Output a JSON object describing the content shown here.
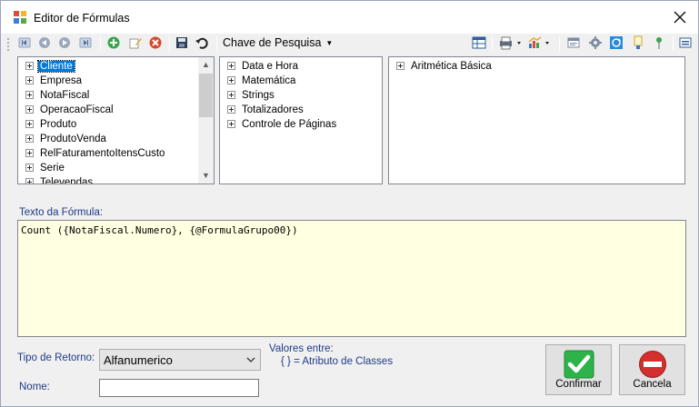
{
  "window": {
    "title": "Editor de Fórmulas"
  },
  "toolbar": {
    "search_label": "Chave de Pesquisa",
    "left_icons": [
      "first-icon",
      "prev-icon",
      "next-icon",
      "last-icon",
      "add-icon",
      "edit-icon",
      "delete-icon",
      "save-icon",
      "undo-icon"
    ],
    "right_icons": [
      "grid-icon",
      "print-icon",
      "chart-icon",
      "window-icon",
      "gear-icon",
      "refresh-icon",
      "filter-icon",
      "pin-icon",
      "menu-icon"
    ]
  },
  "tree_left": {
    "items": [
      "Cliente",
      "Empresa",
      "NotaFiscal",
      "OperacaoFiscal",
      "Produto",
      "ProdutoVenda",
      "RelFaturamentoItensCusto",
      "Serie",
      "Televendas"
    ],
    "selected": "Cliente"
  },
  "tree_middle": {
    "items": [
      "Data e Hora",
      "Matemática",
      "Strings",
      "Totalizadores",
      "Controle de Páginas"
    ]
  },
  "tree_right": {
    "items": [
      "Aritmética Básica"
    ]
  },
  "formula": {
    "label": "Texto da Fórmula:",
    "text": "Count ({NotaFiscal.Numero}, {@FormulaGrupo00})"
  },
  "return_type": {
    "label": "Tipo de Retorno:",
    "value": "Alfanumerico"
  },
  "hint": {
    "line1": "Valores entre:",
    "line2": "{ } = Atributo de Classes"
  },
  "name_field": {
    "label": "Nome:",
    "value": ""
  },
  "buttons": {
    "confirm": "Confirmar",
    "cancel": "Cancela"
  },
  "colors": {
    "selection": "#0078d7",
    "formula_bg": "#ffffe1",
    "label_blue": "#1f3a8a",
    "confirm_green": "#2db34a",
    "cancel_red": "#d32f2f"
  }
}
